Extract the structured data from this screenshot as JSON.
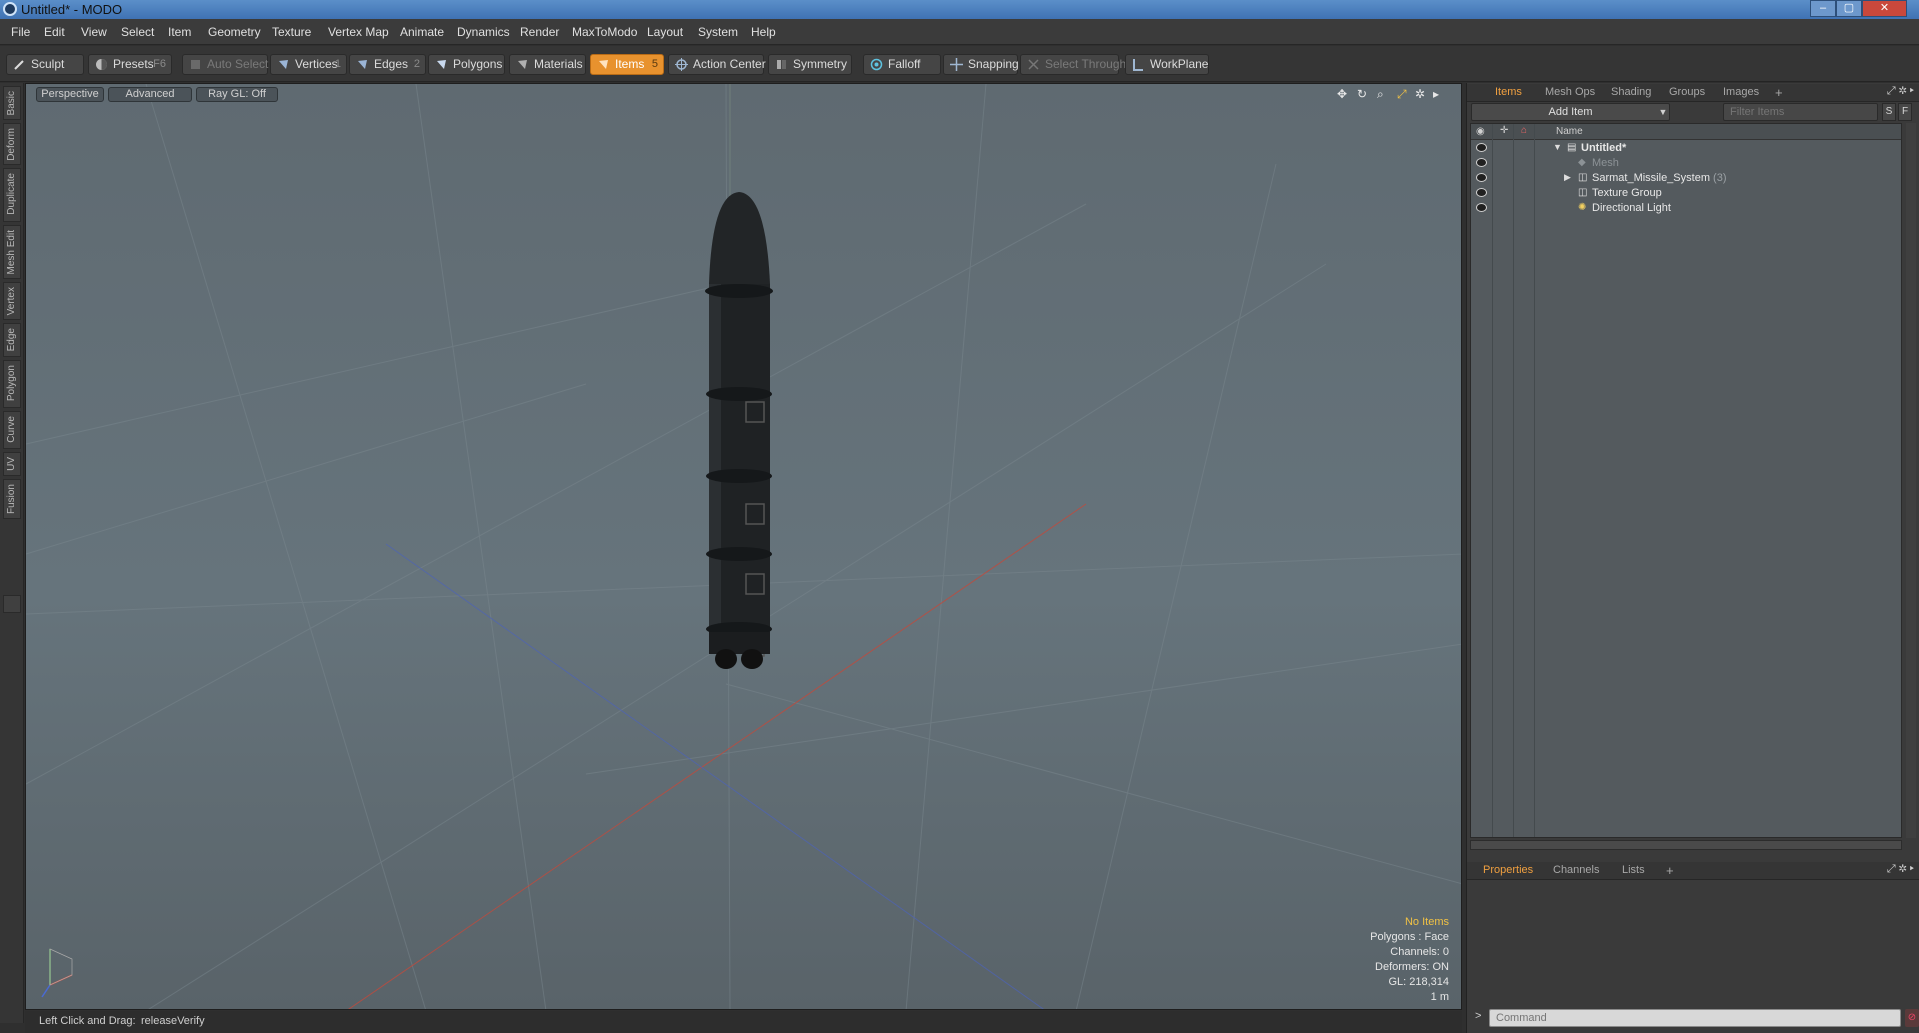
{
  "window": {
    "title": "Untitled* - MODO",
    "min": "–",
    "max": "▢",
    "close": "✕"
  },
  "menu": [
    "File",
    "Edit",
    "View",
    "Select",
    "Item",
    "Geometry",
    "Texture",
    "Vertex Map",
    "Animate",
    "Dynamics",
    "Render",
    "MaxToModo",
    "Layout",
    "System",
    "Help"
  ],
  "toolbar": {
    "sculpt": "Sculpt",
    "presets": "Presets",
    "presets_key": "F6",
    "auto_select": "Auto Select",
    "vertices": "Vertices",
    "vertices_key": "1",
    "edges": "Edges",
    "edges_key": "2",
    "polygons": "Polygons",
    "materials": "Materials",
    "items": "Items",
    "items_key": "5",
    "action_center": "Action Center",
    "symmetry": "Symmetry",
    "falloff": "Falloff",
    "snapping": "Snapping",
    "select_through": "Select Through",
    "workplane": "WorkPlane",
    "active_color": "#e8922e"
  },
  "left_tabs": [
    "Basic",
    "Deform",
    "Duplicate",
    "Mesh Edit",
    "Vertex",
    "Edge",
    "Polygon",
    "Curve",
    "UV",
    "Fusion"
  ],
  "viewport": {
    "view": "Perspective",
    "mode": "Advanced",
    "raygl": "Ray GL: Off",
    "icons": [
      "move-view-icon",
      "rotate-view-icon",
      "zoom-view-icon",
      "fit-view-icon",
      "settings-icon",
      "expand-arrow-icon"
    ],
    "hud": {
      "selection": "No Items",
      "polygons": "Polygons : Face",
      "channels": "Channels: 0",
      "deformers": "Deformers: ON",
      "gl": "GL: 218,314",
      "scale": "1 m"
    },
    "axis": {
      "x_color": "#d34a3a",
      "y_color": "#6fbf6f",
      "z_color": "#4a6ad3"
    }
  },
  "status": {
    "hint": "Left Click and Drag:",
    "action": "releaseVerify"
  },
  "items_panel": {
    "tabs": [
      "Items",
      "Mesh Ops",
      "Shading",
      "Groups",
      "Images"
    ],
    "add_tab": "+",
    "add_item": "Add Item",
    "filter_placeholder": "Filter Items",
    "btn_s": "S",
    "btn_f": "F",
    "header_name": "Name",
    "tree": [
      {
        "label": "Untitled*",
        "level": 0,
        "bold": true,
        "expander": "▼",
        "count": ""
      },
      {
        "label": "Mesh",
        "level": 1,
        "dim": true,
        "expander": "",
        "count": ""
      },
      {
        "label": "Sarmat_Missile_System",
        "level": 1,
        "expander": "▶",
        "count": "(3)"
      },
      {
        "label": "Texture Group",
        "level": 1,
        "expander": "",
        "count": ""
      },
      {
        "label": "Directional Light",
        "level": 1,
        "expander": "",
        "count": ""
      }
    ]
  },
  "props_panel": {
    "tabs": [
      "Properties",
      "Channels",
      "Lists"
    ],
    "add_tab": "+"
  },
  "command": {
    "prompt": ">",
    "placeholder": "Command"
  }
}
